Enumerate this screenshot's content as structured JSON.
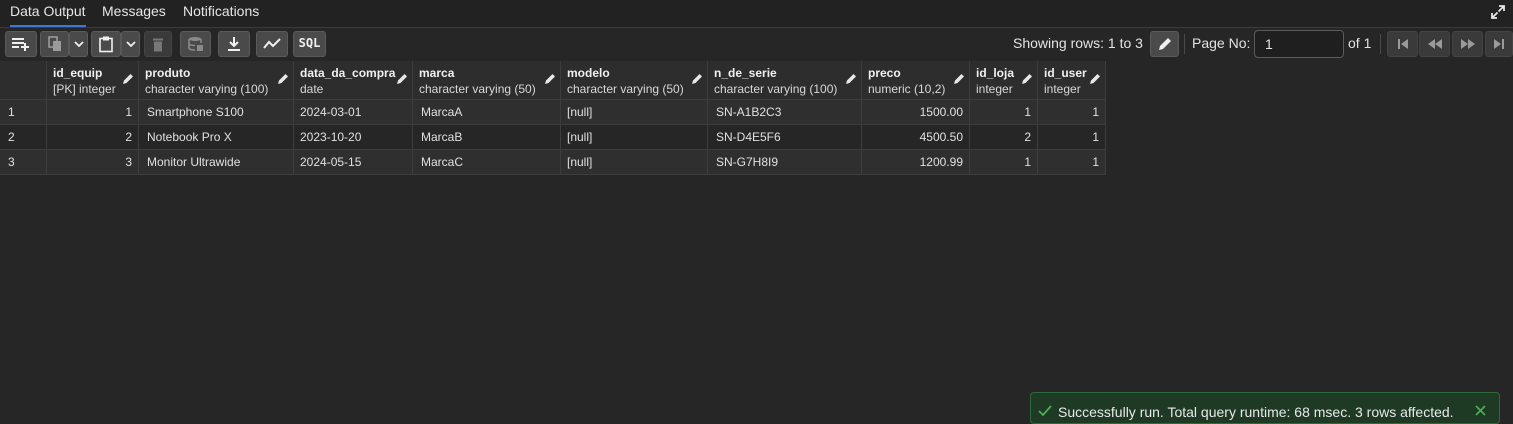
{
  "tabs": [
    {
      "label": "Data Output",
      "active": true
    },
    {
      "label": "Messages",
      "active": false
    },
    {
      "label": "Notifications",
      "active": false
    }
  ],
  "toolbar": {
    "sql_label": "SQL",
    "rows_info": "Showing rows: 1 to 3",
    "page_label": "Page No:",
    "page_value": "1",
    "page_of": "of 1",
    "icons": [
      "add-row-icon",
      "copy-icon",
      "copy-options-chevron-icon",
      "paste-icon",
      "paste-options-chevron-icon",
      "delete-icon",
      "save-data-icon",
      "download-icon",
      "graph-visualiser-icon",
      "sql-icon",
      "edit-rows-icon",
      "first-page-icon",
      "prev-page-icon",
      "next-page-icon",
      "last-page-icon"
    ]
  },
  "grid": {
    "columns": [
      {
        "name": "id_equip",
        "type": "[PK] integer"
      },
      {
        "name": "produto",
        "type": "character varying (100)"
      },
      {
        "name": "data_da_compra",
        "type": "date"
      },
      {
        "name": "marca",
        "type": "character varying (50)"
      },
      {
        "name": "modelo",
        "type": "character varying (50)"
      },
      {
        "name": "n_de_serie",
        "type": "character varying (100)"
      },
      {
        "name": "preco",
        "type": "numeric (10,2)"
      },
      {
        "name": "id_loja",
        "type": "integer"
      },
      {
        "name": "id_user",
        "type": "integer"
      }
    ],
    "rows": [
      {
        "n": "1",
        "cells": [
          "1",
          "Smartphone S100",
          "2024-03-01",
          "MarcaA",
          "[null]",
          "SN-A1B2C3",
          "1500.00",
          "1",
          "1"
        ]
      },
      {
        "n": "2",
        "cells": [
          "2",
          "Notebook Pro X",
          "2023-10-20",
          "MarcaB",
          "[null]",
          "SN-D4E5F6",
          "4500.50",
          "2",
          "1"
        ]
      },
      {
        "n": "3",
        "cells": [
          "3",
          "Monitor Ultrawide",
          "2024-05-15",
          "MarcaC",
          "[null]",
          "SN-G7H8I9",
          "1200.99",
          "1",
          "1"
        ]
      }
    ]
  },
  "toast": {
    "message": "Successfully run. Total query runtime: 68 msec. 3 rows affected.",
    "color": "#1e3a25"
  },
  "colors": {
    "background": "#262626",
    "accent": "#3b79d8",
    "success": "#2e6b3b"
  }
}
